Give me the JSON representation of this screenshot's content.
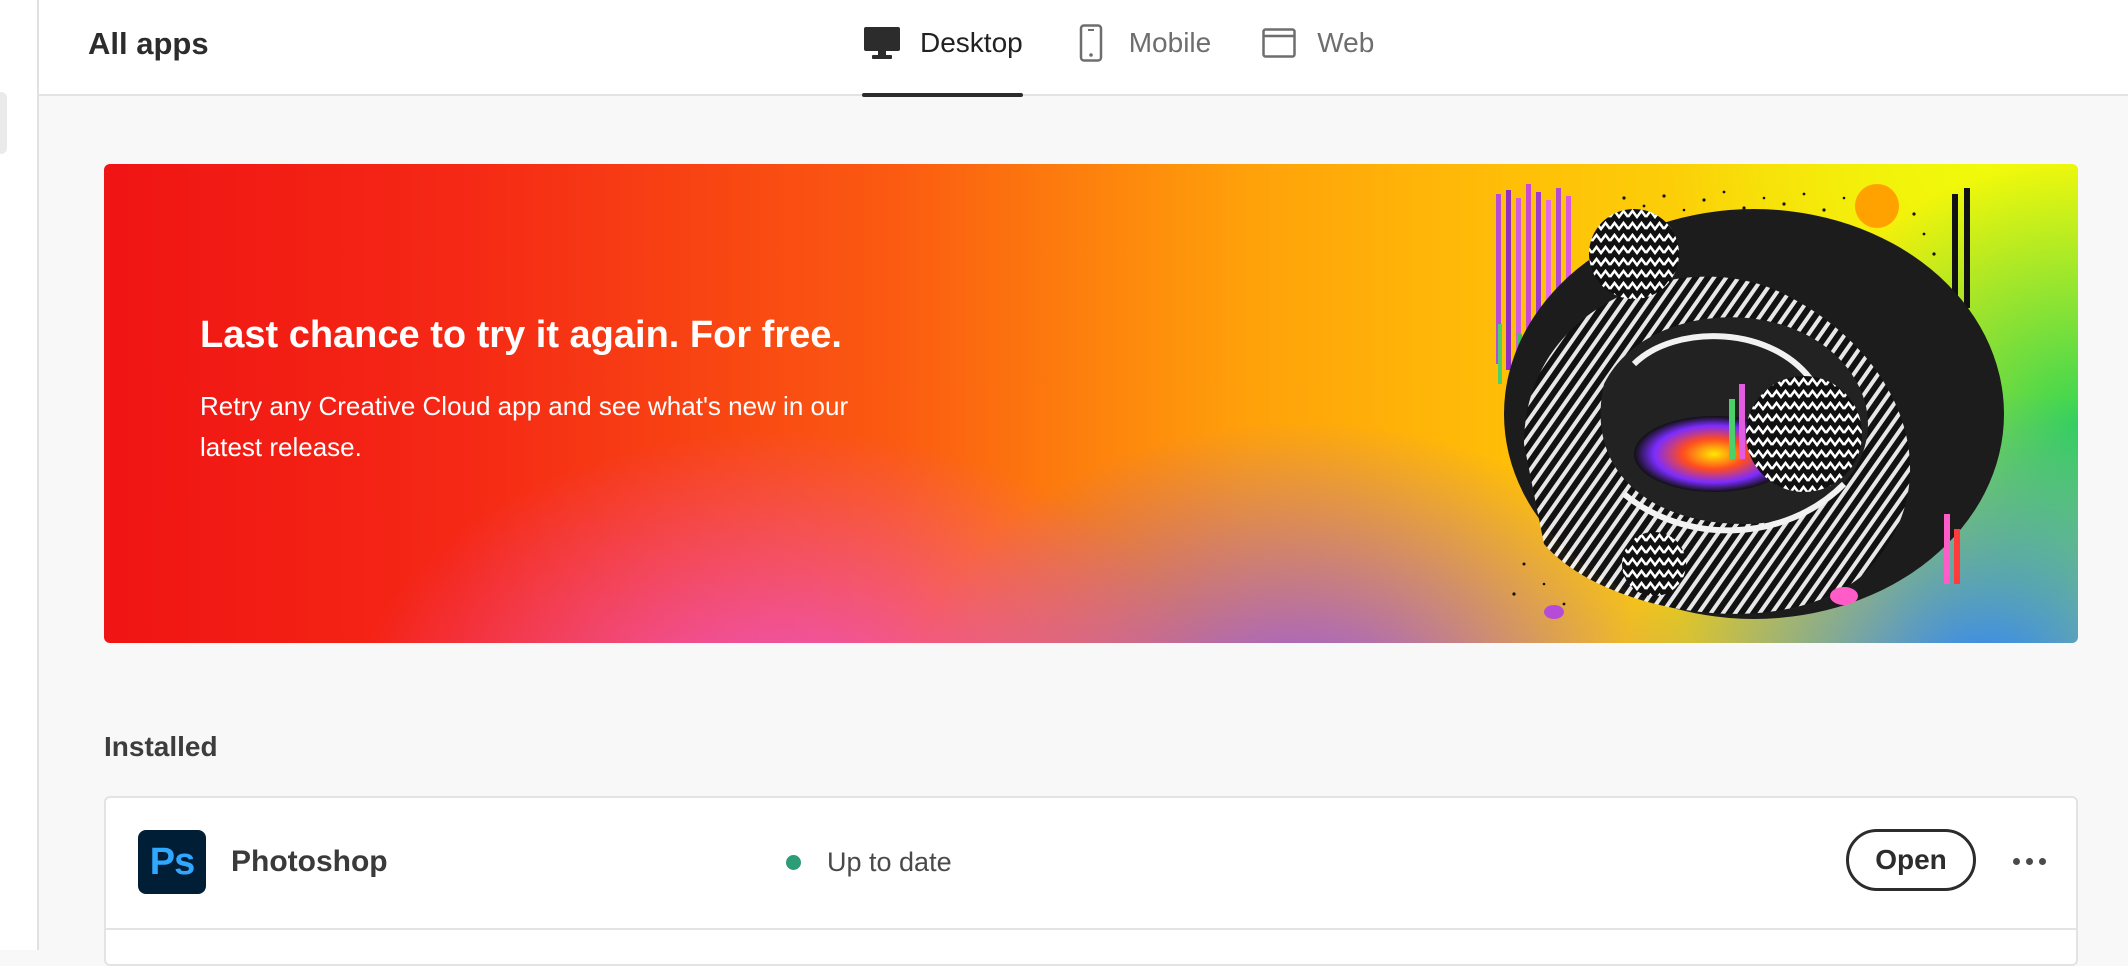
{
  "header": {
    "title": "All apps",
    "tabs": [
      {
        "label": "Desktop",
        "icon": "desktop-icon",
        "active": true
      },
      {
        "label": "Mobile",
        "icon": "mobile-icon",
        "active": false
      },
      {
        "label": "Web",
        "icon": "browser-window-icon",
        "active": false
      }
    ]
  },
  "banner": {
    "title": "Last chance to try it again. For free.",
    "subtitle": "Retry any Creative Cloud app and see what's new in our latest release."
  },
  "installed": {
    "section_title": "Installed",
    "apps": [
      {
        "logo_text": "Ps",
        "name": "Photoshop",
        "status": "Up to date",
        "status_color": "#2d9d78",
        "action_label": "Open"
      }
    ]
  },
  "colors": {
    "ps_logo_bg": "#001e36",
    "ps_logo_fg": "#31a8ff",
    "status_ok": "#2d9d78"
  }
}
